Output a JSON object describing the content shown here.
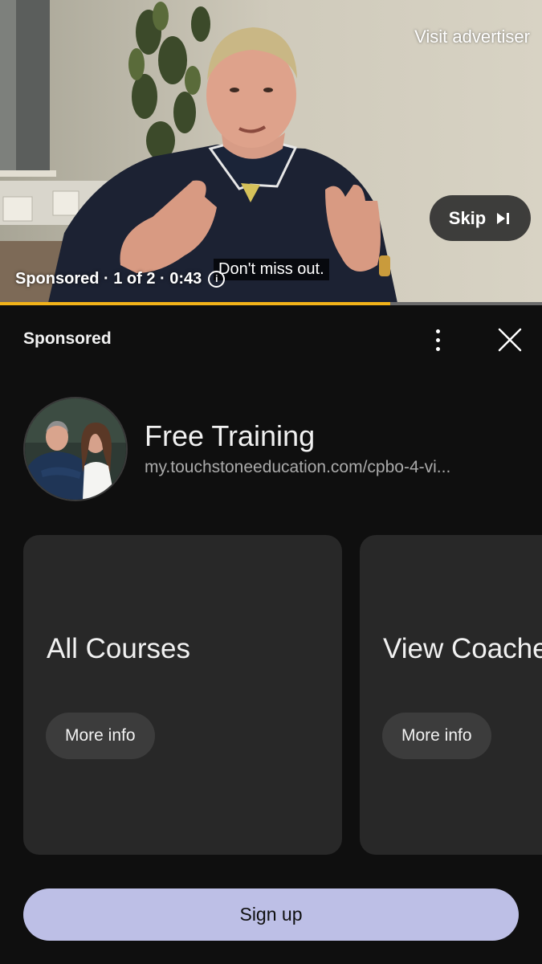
{
  "video": {
    "visit_advertiser": "Visit advertiser",
    "skip_label": "Skip",
    "status": "Sponsored · 1 of 2 · 0:43",
    "caption": "Don't miss out.",
    "progress": 0.72
  },
  "panel": {
    "sponsored": "Sponsored",
    "advertiser": {
      "title": "Free Training",
      "url": "my.touchstoneeducation.com/cpbo-4-vi..."
    },
    "cards": [
      {
        "title": "All Courses",
        "button": "More info"
      },
      {
        "title": "View Coaches",
        "button": "More info"
      }
    ],
    "cta": "Sign up"
  },
  "colors": {
    "progress": "#f2b319",
    "cta_background": "#bdbfe6",
    "panel_background": "#0f0f0f",
    "card_background": "#282828"
  },
  "icons": [
    "skip-next-icon",
    "info-icon",
    "more-vertical-icon",
    "close-icon"
  ]
}
